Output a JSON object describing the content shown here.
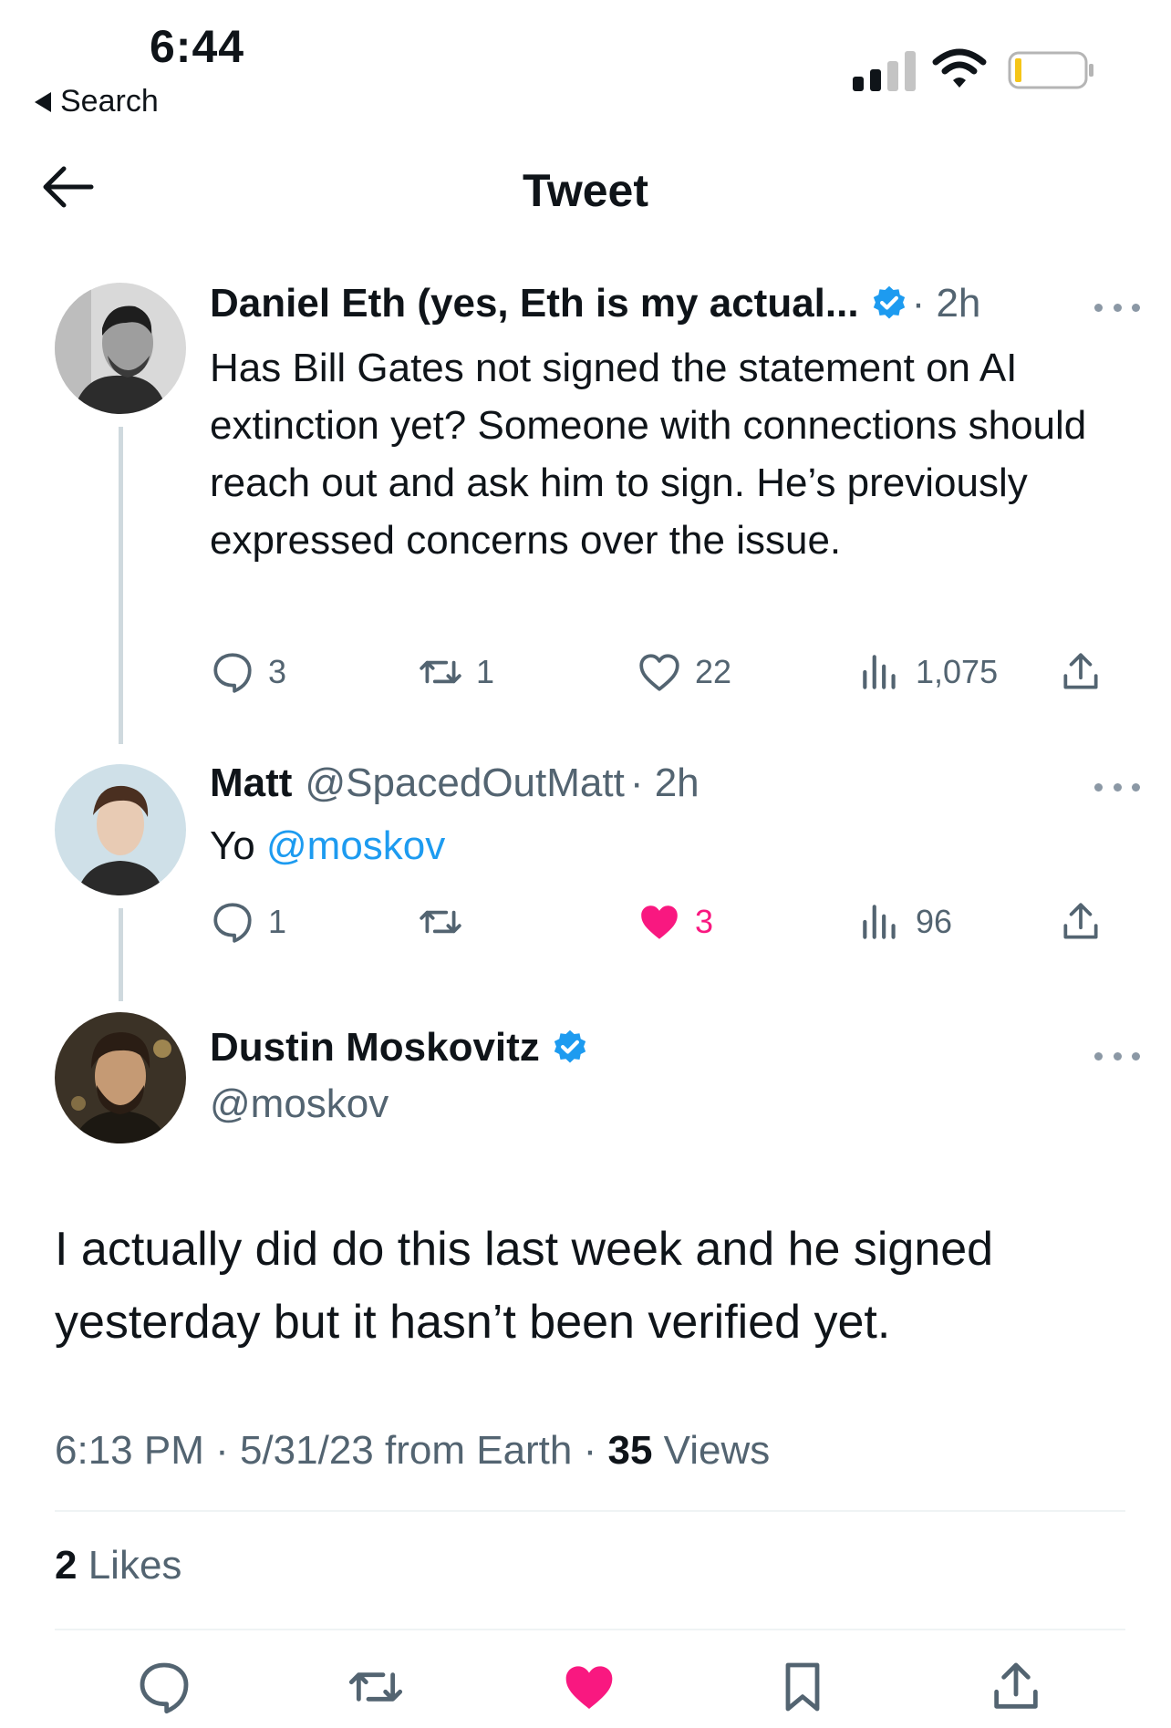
{
  "status_bar": {
    "time": "6:44",
    "back_app": "Search"
  },
  "header": {
    "title": "Tweet"
  },
  "thread": [
    {
      "name": "Daniel Eth (yes, Eth is my actual...",
      "meta": "· 2h",
      "verified": true,
      "text": "Has Bill Gates not signed the statement on AI extinction yet? Someone with connections should reach out and ask him to sign. He’s previously expressed concerns over the issue.",
      "replies": "3",
      "retweets": "1",
      "likes": "22",
      "views": "1,075"
    },
    {
      "name": "Matt",
      "handle": "@SpacedOutMatt",
      "meta": "· 2h",
      "text_prefix": "Yo ",
      "mention": "@moskov",
      "replies": "1",
      "retweets": "",
      "likes": "3",
      "views": "96"
    }
  ],
  "main_tweet": {
    "name": "Dustin Moskovitz",
    "handle": "@moskov",
    "verified": true,
    "text": "I actually did do this last week and he signed yesterday but it hasn’t been verified yet.",
    "time": "6:13 PM · 5/31/23 from Earth · ",
    "views_count": "35",
    "views_label": " Views",
    "likes_count": "2",
    "likes_label": " Likes"
  },
  "colors": {
    "accent": "#1d9bf0",
    "like": "#f91880",
    "muted": "#536471",
    "line": "#cfd9de"
  },
  "icons": [
    "back-arrow-icon",
    "verified-badge-icon",
    "more-icon",
    "reply-icon",
    "retweet-icon",
    "like-icon",
    "views-icon",
    "share-icon",
    "bookmark-icon"
  ]
}
